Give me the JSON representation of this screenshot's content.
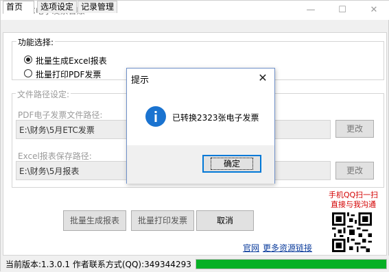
{
  "window": {
    "title": "ETC电子发票台账",
    "min_glyph": "—",
    "max_glyph": "☐",
    "close_glyph": "✕"
  },
  "tabs": [
    {
      "label": "首页",
      "active": true
    },
    {
      "label": "选项设定",
      "active": false
    },
    {
      "label": "记录管理",
      "active": false
    }
  ],
  "function_group": {
    "label": "功能选择:",
    "options": [
      {
        "label": "批量生成Excel报表",
        "selected": true
      },
      {
        "label": "批量打印PDF发票",
        "selected": false
      }
    ]
  },
  "path_group": {
    "label": "文件路径设定:",
    "pdf_label": "PDF电子发票文件路径:",
    "pdf_path": "E:\\财务\\5月ETC发票",
    "excel_label": "Excel报表保存路径:",
    "excel_path": "E:\\财务\\5月报表",
    "change_label": "更改"
  },
  "buttons": {
    "report": "批量生成报表",
    "print": "批量打印发票",
    "cancel": "取消"
  },
  "promo": {
    "line1": "手机QQ扫一扫",
    "line2": "直接与我沟通"
  },
  "links": {
    "site": "官网",
    "more": "更多资源链接"
  },
  "status": {
    "text": "当前版本:1.3.0.1  作者联系方式(QQ):349344293",
    "progress_fraction": 1.0
  },
  "dialog": {
    "title": "提示",
    "icon": "info-icon",
    "message": "已转换2323张电子发票",
    "ok_label": "确定",
    "close_glyph": "✕"
  },
  "colors": {
    "progress": "#06b025",
    "promo": "#d30000",
    "link": "#0b3c9c",
    "info_icon": "#1a73d0"
  }
}
